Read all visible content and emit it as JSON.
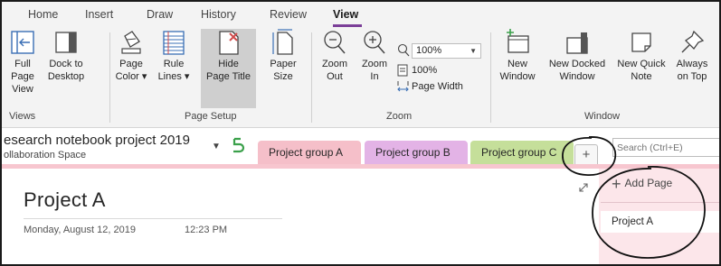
{
  "ribbon_tabs": [
    "Home",
    "Insert",
    "Draw",
    "History",
    "Review",
    "View"
  ],
  "active_tab": "View",
  "views_group": {
    "label": "Views",
    "full_page_view": [
      "Full Page",
      "View"
    ],
    "dock_to_desktop": [
      "Dock to",
      "Desktop"
    ]
  },
  "page_setup_group": {
    "label": "Page Setup",
    "page_color": [
      "Page",
      "Color ▾"
    ],
    "rule_lines": [
      "Rule",
      "Lines ▾"
    ],
    "hide_page_title": [
      "Hide",
      "Page Title"
    ],
    "paper_size": [
      "Paper",
      "Size"
    ]
  },
  "zoom_group": {
    "label": "Zoom",
    "zoom_out": [
      "Zoom",
      "Out"
    ],
    "zoom_in": [
      "Zoom",
      "In"
    ],
    "zoom_value": "100%",
    "hundred_percent": "100%",
    "page_width": "Page Width"
  },
  "window_group": {
    "label": "Window",
    "new_window": [
      "New",
      "Window"
    ],
    "new_docked_window": [
      "New Docked",
      "Window"
    ],
    "new_quick_note": [
      "New Quick",
      "Note"
    ],
    "always_on_top": [
      "Always",
      "on Top"
    ]
  },
  "notebook": {
    "title": "esearch notebook project 2019",
    "subtitle": "ollaboration Space"
  },
  "sections": [
    {
      "label": "Project group A",
      "color": "#f5bfc9"
    },
    {
      "label": "Project group B",
      "color": "#e3b3e6"
    },
    {
      "label": "Project group C",
      "color": "#c5df9a"
    }
  ],
  "add_section": "+",
  "search_placeholder": "Search (Ctrl+E)",
  "page": {
    "title": "Project A",
    "date": "Monday, August 12, 2019",
    "time": "12:23 PM"
  },
  "pages_pane": {
    "add_page": "Add Page",
    "items": [
      "Project A"
    ]
  },
  "colors": {
    "accent": "#7b3f98",
    "ribbon_bg": "#f3f3f3",
    "section_band": "#f7c6cf",
    "pages_pane_bg": "#fce6ea"
  }
}
